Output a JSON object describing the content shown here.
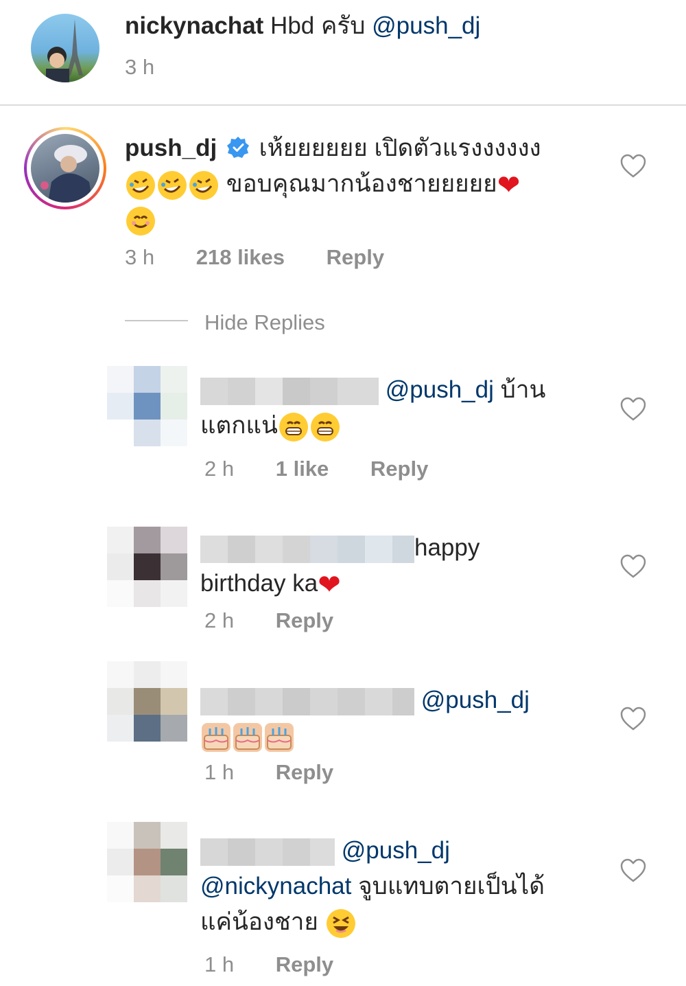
{
  "top_comment": {
    "username": "nickynachat",
    "text": "Hbd ครับ",
    "mention": "@push_dj",
    "time": "3 h"
  },
  "main_comment": {
    "username": "push_dj",
    "line1": "เห้ยยยยยย เปิดตัวแรงงงงงง",
    "line2": "ขอบคุณมากน้องชายยยยย",
    "time": "3 h",
    "likes": "218 likes",
    "reply": "Reply",
    "hide_replies": "Hide Replies"
  },
  "replies": [
    {
      "mention": "@push_dj",
      "text_a": "บ้าน",
      "text_b": "แตกแน่",
      "time": "2 h",
      "likes": "1 like",
      "reply": "Reply"
    },
    {
      "text_a": "happy",
      "text_b": "birthday ka",
      "time": "2 h",
      "reply": "Reply"
    },
    {
      "mention": "@push_dj",
      "time": "1 h",
      "reply": "Reply"
    },
    {
      "mention": "@push_dj",
      "mention2": "@nickynachat",
      "text_a": "จูบแทบตายเป็นได้",
      "text_b": "แค่น้องชาย",
      "time": "1 h",
      "reply": "Reply"
    }
  ],
  "colors": {
    "mention": "#00376b",
    "muted": "#8e8e8e",
    "verified": "#3897f0",
    "heart_red": "#e0151f"
  }
}
